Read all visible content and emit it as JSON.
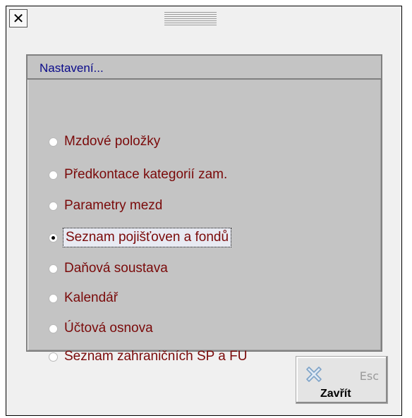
{
  "window": {
    "close_glyph": "✕"
  },
  "group": {
    "title": "Nastavení...",
    "items": [
      {
        "label": "Mzdové položky",
        "selected": false
      },
      {
        "label": "Předkontace kategorií zam.",
        "selected": false
      },
      {
        "label": "Parametry mezd",
        "selected": false
      },
      {
        "label": "Seznam pojišťoven a fondů",
        "selected": true
      },
      {
        "label": "Daňová soustava",
        "selected": false
      },
      {
        "label": "Kalendář",
        "selected": false
      },
      {
        "label": "Účtová osnova",
        "selected": false
      },
      {
        "label": "Seznam zahraničních SP a FU",
        "selected": false
      }
    ]
  },
  "actions": {
    "close_label": "Zavřít",
    "close_shortcut": "Esc",
    "close_icon": "close-x-icon"
  },
  "colors": {
    "label_text": "#7a0a0a",
    "title_text": "#0a0a8a",
    "panel_bg": "#c4c4c4",
    "icon_blue": "#7fa4c8"
  }
}
